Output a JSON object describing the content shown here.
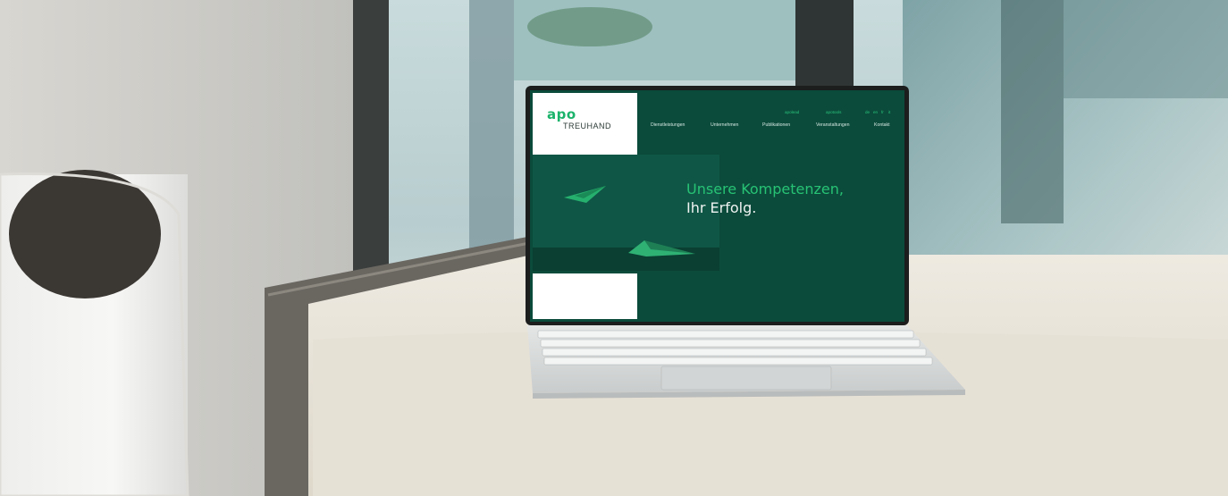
{
  "website": {
    "logo": {
      "brand": "apo",
      "sub": "TREUHAND"
    },
    "top_links": [
      "apolead",
      "apotools",
      "de",
      "en",
      "fr",
      "it"
    ],
    "nav": [
      "Dienstleistungen",
      "Unternehmen",
      "Publikationen",
      "Veranstaltungen",
      "Kontakt"
    ],
    "hero": {
      "line1": "Unsere Kompetenzen,",
      "line2": "Ihr Erfolg."
    }
  },
  "colors": {
    "brand_green": "#27c274",
    "screen_bg": "#0b4b3b",
    "panel": "#0f5646",
    "laptop_silver": "#d9dbdb",
    "cushion": "#e9e4d9"
  }
}
